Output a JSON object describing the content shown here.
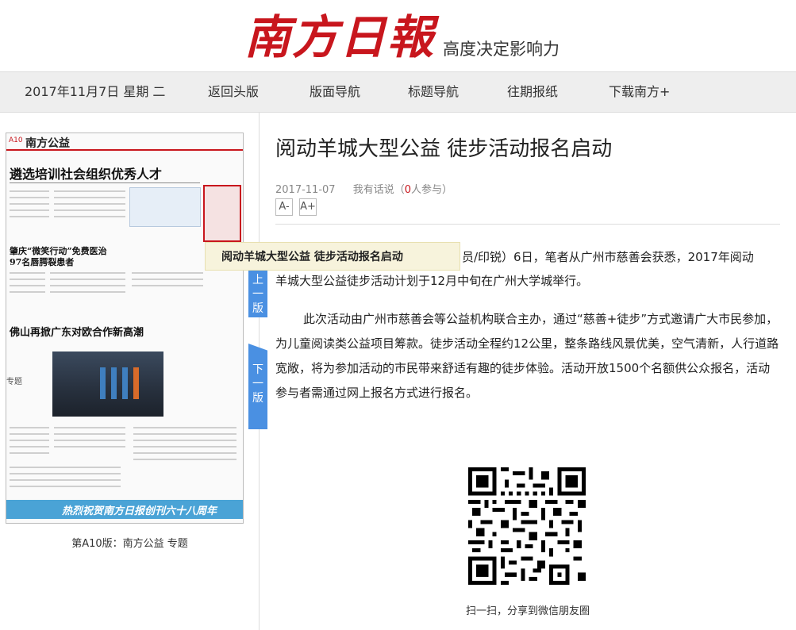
{
  "header": {
    "logo": "南方日報",
    "slogan": "高度决定影响力"
  },
  "nav": {
    "date": "2017年11月7日 星期 二",
    "items": [
      "返回头版",
      "版面导航",
      "标题导航",
      "往期报纸",
      "下载南方+"
    ]
  },
  "page_thumb": {
    "page_no": "A10",
    "section": "南方公益",
    "headline_1": "遴选培训社会组织优秀人才",
    "headline_2": "肇庆“微笑行动”免费医治",
    "headline_3": "97名唇腭裂患者",
    "headline_4": "佛山再掀广东对欧合作新高潮",
    "banner": "热烈祝贺南方日报创刊六十八周年",
    "bottom_label": "专题",
    "caption": "第A10版：南方公益 专题"
  },
  "tooltip": "阅动羊城大型公益 徒步活动报名启动",
  "side_nav": {
    "prev": "上一版",
    "next": "下一版"
  },
  "article": {
    "title": "阅动羊城大型公益 徒步活动报名启动",
    "date": "2017-11-07",
    "comment_prefix": "我有话说（",
    "comment_count": "0",
    "comment_suffix": "人参与）",
    "font_smaller": "A-",
    "font_larger": "A+",
    "para_1_a": "员/印锐）6日，笔者从广州市慈善会获悉，2017年阅动",
    "para_1_b": "羊城大型公益徒步活动计划于12月中旬在广州大学城举行。",
    "para_2": "此次活动由广州市慈善会等公益机构联合主办，通过“慈善+徒步”方式邀请广大市民参加，为儿童阅读类公益项目筹款。徒步活动全程约12公里，整条路线风景优美，空气清新，人行道路宽敞，将为参加活动的市民带来舒适有趣的徒步体验。活动开放1500个名额供公众报名，活动参与者需通过网上报名方式进行报名。",
    "qr_caption": "扫一扫，分享到微信朋友圈"
  },
  "colors": {
    "brand_red": "#c8161d",
    "tab_blue": "#4a90e2",
    "nav_bg": "#eeeeee",
    "tooltip_bg": "#f7f3dc"
  }
}
